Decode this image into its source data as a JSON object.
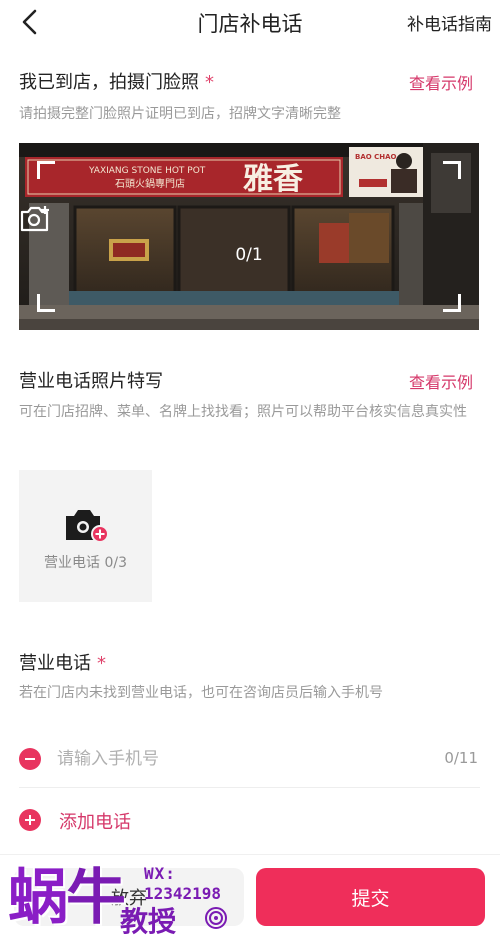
{
  "nav": {
    "title": "门店补电话",
    "guide_label": "补电话指南"
  },
  "storefront_section": {
    "title": "我已到店，拍摄门脸照",
    "required_mark": "*",
    "example_link": "查看示例",
    "description": "请拍摄完整门脸照片证明已到店，招牌文字清晰完整",
    "photo_counter": "0/1",
    "sign": {
      "english": "YAXIANG STONE HOT POT",
      "chinese_small": "石頭火鍋專門店",
      "chinese_big": "雅香",
      "side_sign": "BAO CHAO"
    }
  },
  "phone_photo_section": {
    "title": "营业电话照片特写",
    "example_link": "查看示例",
    "description": "可在门店招牌、菜单、名牌上找找看；照片可以帮助平台核实信息真实性",
    "upload_label": "营业电话 0/3"
  },
  "phone_section": {
    "title": "营业电话",
    "required_mark": "*",
    "description": "若在门店内未找到营业电话，也可在咨询店员后输入手机号",
    "input_placeholder": "请输入手机号",
    "input_value": "",
    "input_counter": "0/11",
    "add_phone_label": "添加电话"
  },
  "footer": {
    "cancel_label": "放弃",
    "submit_label": "提交"
  },
  "watermark": {
    "glyph_1": "蜗",
    "glyph_2": "牛",
    "wx_label": "WX:",
    "wx_number": "12342198",
    "jiao": "教授"
  },
  "colors": {
    "accent_pink": "#ef2e5a",
    "link_pink": "#d5386a",
    "text_gray": "#9a9a9a",
    "watermark_purple": "#7a1bb3"
  },
  "icons": {
    "back": "chevron-left-icon",
    "camera_add": "camera-add-icon",
    "camera_plus_filled": "camera-plus-icon",
    "remove": "minus-circle-icon",
    "add": "plus-circle-icon"
  }
}
